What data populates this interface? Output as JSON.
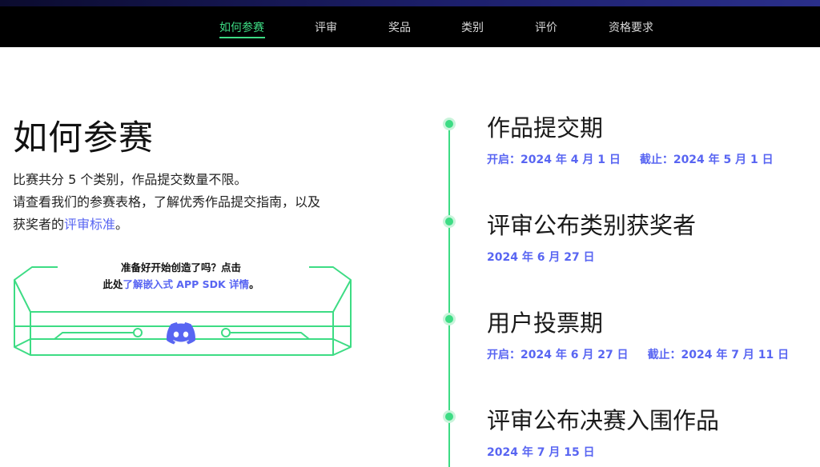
{
  "nav": {
    "items": [
      {
        "label": "如何参赛",
        "active": true
      },
      {
        "label": "评审",
        "active": false
      },
      {
        "label": "奖品",
        "active": false
      },
      {
        "label": "类别",
        "active": false
      },
      {
        "label": "评价",
        "active": false
      },
      {
        "label": "资格要求",
        "active": false
      }
    ]
  },
  "main": {
    "title": "如何参赛",
    "intro_line1": "比赛共分 5 个类别，作品提交数量不限。",
    "intro_line2": "请查看我们的参赛表格，了解优秀作品提交指南，以及",
    "intro_line3_prefix": "获奖者的",
    "intro_link": "评审标准",
    "intro_line3_suffix": "。"
  },
  "banner": {
    "line1": "准备好开始创造了吗？点击",
    "line2_prefix": "此处",
    "link": "了解嵌入式 APP SDK 详情",
    "line2_suffix": "。",
    "icon": "discord-icon"
  },
  "timeline": [
    {
      "title": "作品提交期",
      "start": "开启：2024 年 4 月 1 日",
      "end": "截止：2024 年 5 月 1 日"
    },
    {
      "title": "评审公布类别获奖者",
      "date": "2024 年 6 月 27 日"
    },
    {
      "title": "用户投票期",
      "start": "开启：2024 年 6 月 27 日",
      "end": "截止：2024 年 7 月 11 日"
    },
    {
      "title": "评审公布决赛入围作品",
      "date": "2024 年 7 月 15 日"
    }
  ],
  "colors": {
    "accent_green": "#3ddc84",
    "link_blue": "#5865f2",
    "nav_bg": "#000000"
  }
}
